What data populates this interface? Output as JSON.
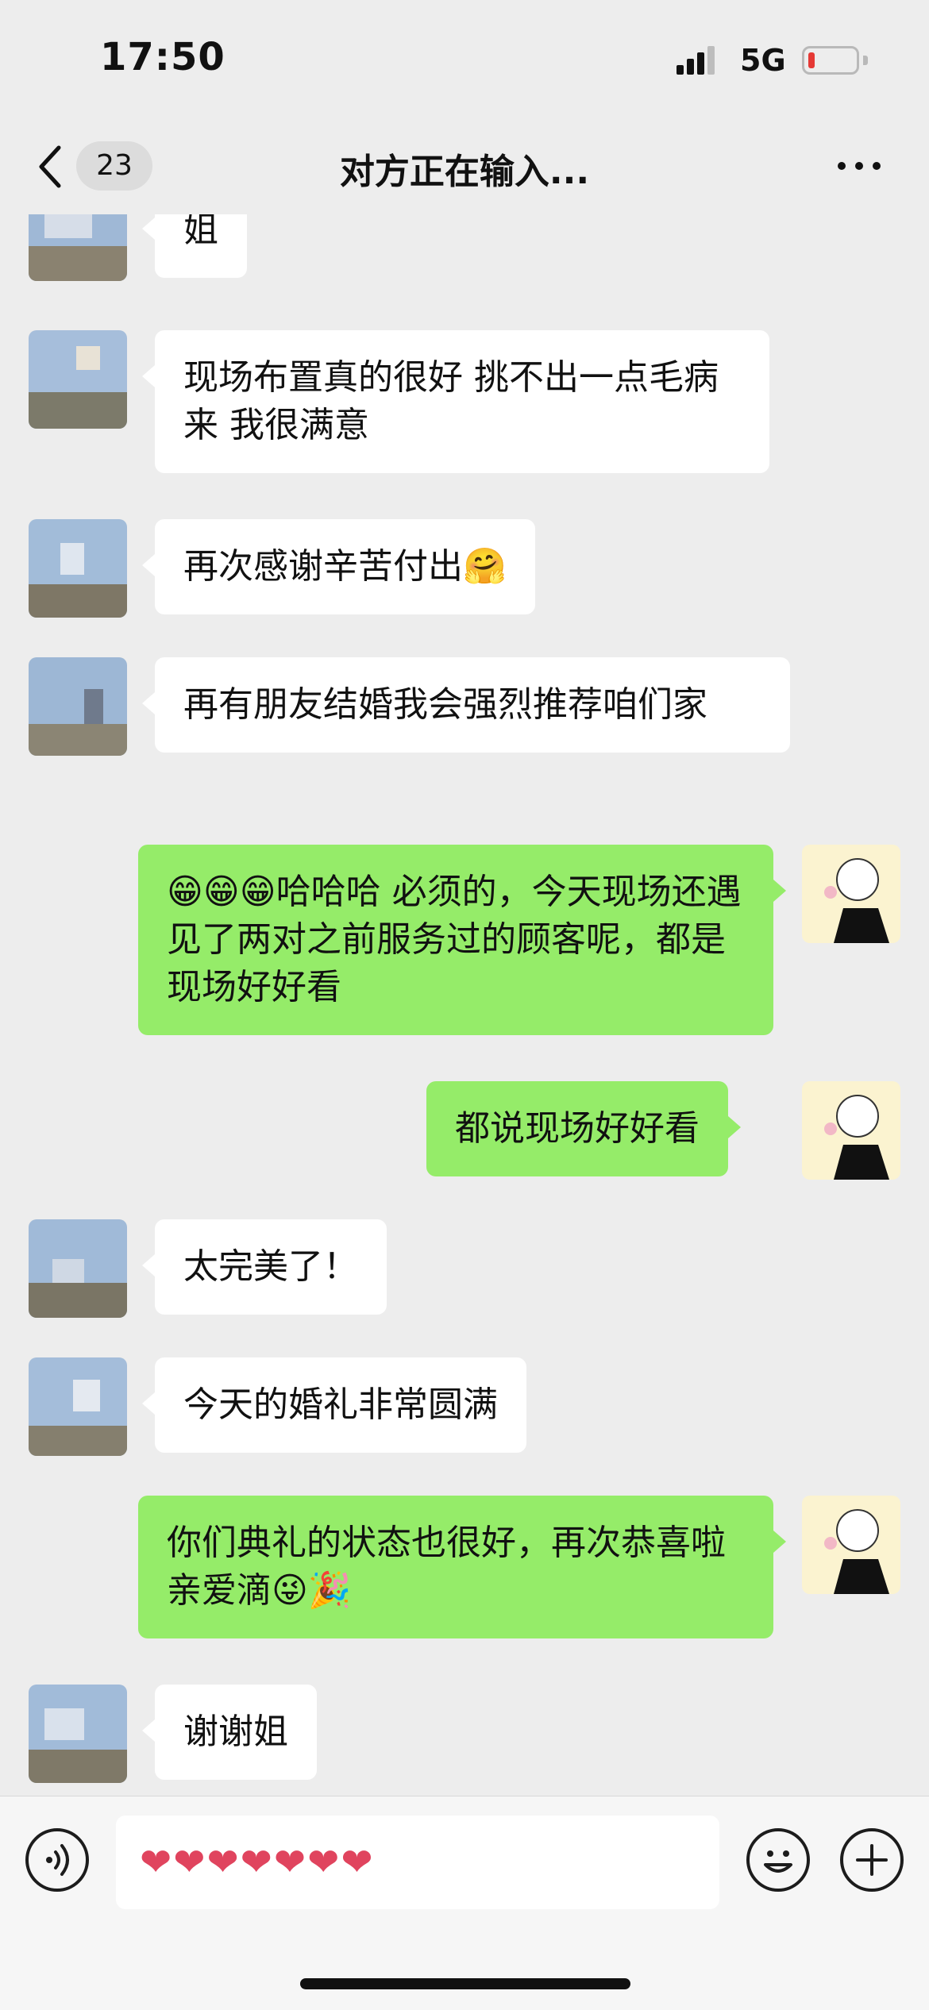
{
  "status_bar": {
    "time": "17:50",
    "network": "5G",
    "battery_low_color": "#e53935"
  },
  "nav": {
    "unread_count": "23",
    "title": "对方正在输入..."
  },
  "messages": [
    {
      "side": "in",
      "text": "姐"
    },
    {
      "side": "in",
      "text": "现场布置真的很好  挑不出一点毛病来  我很满意"
    },
    {
      "side": "in",
      "text": "再次感谢辛苦付出",
      "emoji": "🤗"
    },
    {
      "side": "in",
      "text": "再有朋友结婚我会强烈推荐咱们家"
    },
    {
      "side": "out",
      "emoji_prefix": "😁😁😁",
      "text": "哈哈哈 必须的，今天现场还遇见了两对之前服务过的顾客呢，都是现场好好看"
    },
    {
      "side": "out",
      "text": "都说现场好好看"
    },
    {
      "side": "in",
      "text": "太完美了！"
    },
    {
      "side": "in",
      "text": "今天的婚礼非常圆满"
    },
    {
      "side": "out",
      "text": "你们典礼的状态也很好，再次恭喜啦亲爱滴",
      "emoji": "😜🎉"
    },
    {
      "side": "in",
      "text": "谢谢姐"
    }
  ],
  "input": {
    "value": "❤❤❤❤❤❤❤"
  },
  "colors": {
    "outgoing_bubble": "#95ec69",
    "incoming_bubble": "#ffffff",
    "background": "#ededed"
  }
}
